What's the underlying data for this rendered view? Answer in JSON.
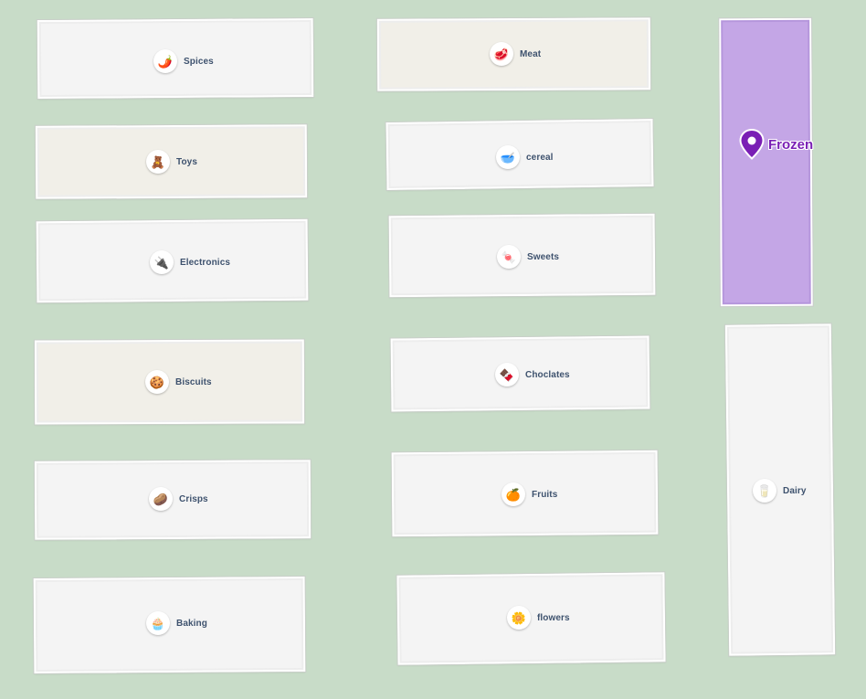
{
  "map": {
    "selected": {
      "label": "Frozen",
      "icon": "location-pin-icon",
      "color": "#7a1fb5",
      "highlight": "#c4a6e6"
    },
    "aisles": [
      {
        "label": "Spices",
        "icon": "spices-product-icon",
        "glyph": "🌶️"
      },
      {
        "label": "Toys",
        "icon": "toys-product-icon",
        "glyph": "🧸"
      },
      {
        "label": "Electronics",
        "icon": "electronics-product-icon",
        "glyph": "🔌"
      },
      {
        "label": "Biscuits",
        "icon": "biscuits-product-icon",
        "glyph": "🍪"
      },
      {
        "label": "Crisps",
        "icon": "crisps-product-icon",
        "glyph": "🥔"
      },
      {
        "label": "Baking",
        "icon": "baking-product-icon",
        "glyph": "🧁"
      },
      {
        "label": "Meat",
        "icon": "meat-product-icon",
        "glyph": "🥩"
      },
      {
        "label": "cereal",
        "icon": "cereal-product-icon",
        "glyph": "🥣"
      },
      {
        "label": "Sweets",
        "icon": "sweets-product-icon",
        "glyph": "🍬"
      },
      {
        "label": "Choclates",
        "icon": "chocolates-product-icon",
        "glyph": "🍫"
      },
      {
        "label": "Fruits",
        "icon": "fruits-product-icon",
        "glyph": "🍊"
      },
      {
        "label": "flowers",
        "icon": "flowers-product-icon",
        "glyph": "🌼"
      },
      {
        "label": "Dairy",
        "icon": "dairy-product-icon",
        "glyph": "🥛"
      }
    ]
  }
}
